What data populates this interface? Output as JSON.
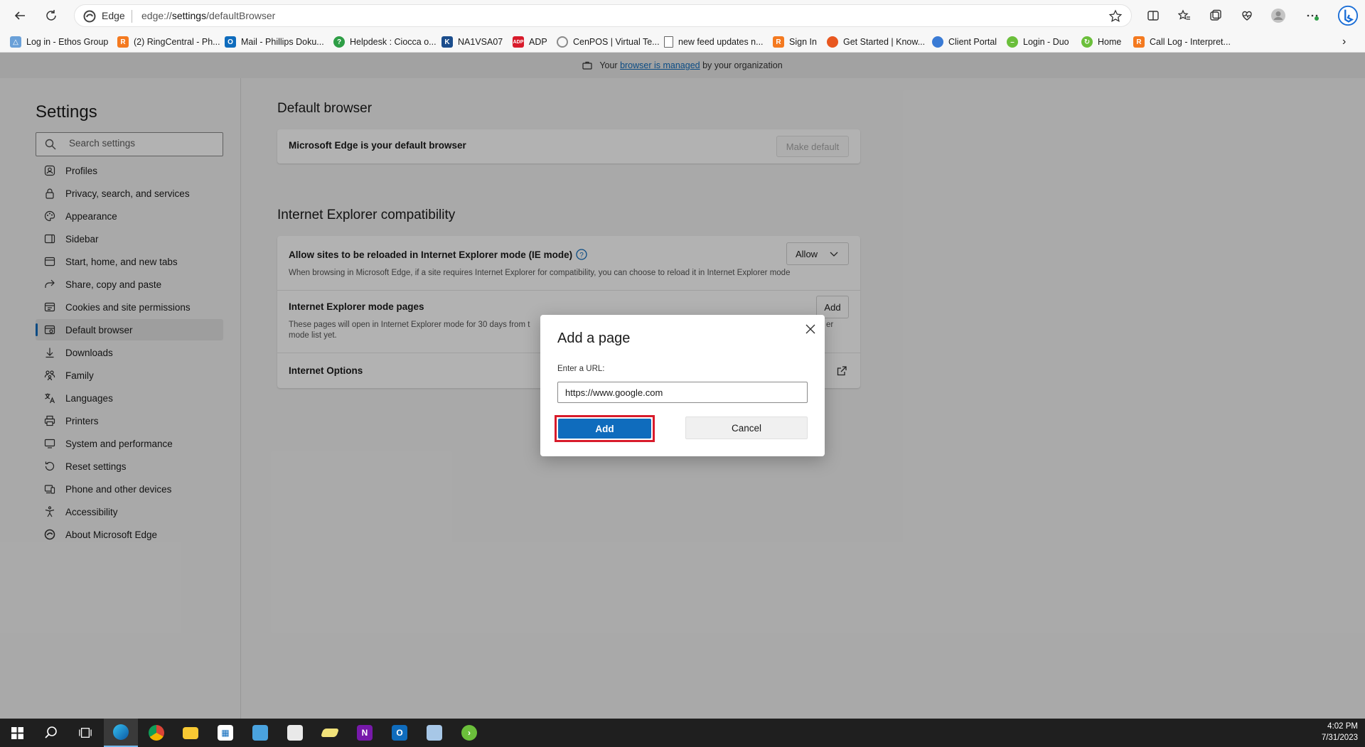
{
  "browser": {
    "site_name": "Edge",
    "url_prefix": "edge://",
    "url_path": "settings",
    "url_rest": "/defaultBrowser"
  },
  "bookmarks": [
    {
      "label": "Log in - Ethos Group",
      "icon": "ethos-icon",
      "color": "#6aa0d8"
    },
    {
      "label": "(2) RingCentral - Ph...",
      "icon": "ringcentral-icon",
      "color": "#f47a20"
    },
    {
      "label": "Mail - Phillips Doku...",
      "icon": "outlook-icon",
      "color": "#0f6cbd"
    },
    {
      "label": "Helpdesk : Ciocca o...",
      "icon": "helpdesk-icon",
      "color": "#2e9e46"
    },
    {
      "label": "NA1VSA07",
      "icon": "kaseya-icon",
      "color": "#1b4d8c"
    },
    {
      "label": "ADP",
      "icon": "adp-icon",
      "color": "#d81b2b"
    },
    {
      "label": "CenPOS | Virtual Te...",
      "icon": "cenpos-icon",
      "color": "#8a8a8a"
    },
    {
      "label": "new feed updates n...",
      "icon": "page-icon",
      "color": "#666666"
    },
    {
      "label": "Sign In",
      "icon": "signin-icon",
      "color": "#f47a20"
    },
    {
      "label": "Get Started | Know...",
      "icon": "knowbe4-icon",
      "color": "#e8571f"
    },
    {
      "label": "Client Portal",
      "icon": "portal-icon",
      "color": "#3a7bd5"
    },
    {
      "label": "Login - Duo",
      "icon": "duo-icon",
      "color": "#6bbf3b"
    },
    {
      "label": "Home",
      "icon": "home-icon",
      "color": "#6bbf3b"
    },
    {
      "label": "Call Log - Interpret...",
      "icon": "calllog-icon",
      "color": "#f47a20"
    }
  ],
  "managed": {
    "prefix": "Your ",
    "link": "browser is managed",
    "suffix": " by your organization"
  },
  "sidebar": {
    "title": "Settings",
    "search_placeholder": "Search settings",
    "items": [
      {
        "label": "Profiles",
        "icon": "profile-icon"
      },
      {
        "label": "Privacy, search, and services",
        "icon": "lock-icon"
      },
      {
        "label": "Appearance",
        "icon": "palette-icon"
      },
      {
        "label": "Sidebar",
        "icon": "sidebar-icon"
      },
      {
        "label": "Start, home, and new tabs",
        "icon": "home-tab-icon"
      },
      {
        "label": "Share, copy and paste",
        "icon": "share-icon"
      },
      {
        "label": "Cookies and site permissions",
        "icon": "cookie-icon"
      },
      {
        "label": "Default browser",
        "icon": "browser-icon",
        "active": true
      },
      {
        "label": "Downloads",
        "icon": "download-icon"
      },
      {
        "label": "Family",
        "icon": "family-icon"
      },
      {
        "label": "Languages",
        "icon": "language-icon"
      },
      {
        "label": "Printers",
        "icon": "printer-icon"
      },
      {
        "label": "System and performance",
        "icon": "system-icon"
      },
      {
        "label": "Reset settings",
        "icon": "reset-icon"
      },
      {
        "label": "Phone and other devices",
        "icon": "phone-icon"
      },
      {
        "label": "Accessibility",
        "icon": "accessibility-icon"
      },
      {
        "label": "About Microsoft Edge",
        "icon": "edge-icon"
      }
    ]
  },
  "main": {
    "default_browser_title": "Default browser",
    "default_browser_status": "Microsoft Edge is your default browser",
    "make_default_label": "Make default",
    "ie_title": "Internet Explorer compatibility",
    "ie_allow_label": "Allow sites to be reloaded in Internet Explorer mode (IE mode)",
    "ie_allow_desc": "When browsing in Microsoft Edge, if a site requires Internet Explorer for compatibility, you can choose to reload it in Internet Explorer mode",
    "ie_allow_value": "Allow",
    "ie_pages_label": "Internet Explorer mode pages",
    "ie_pages_desc_a": "These pages will open in Internet Explorer mode for 30 days from t",
    "ie_pages_desc_b": "mode list yet.",
    "ie_pages_desc_tail": "er",
    "ie_pages_add": "Add",
    "internet_options_label": "Internet Options"
  },
  "dialog": {
    "title": "Add a page",
    "url_label": "Enter a URL:",
    "url_value": "https://www.google.com",
    "add_label": "Add",
    "cancel_label": "Cancel"
  },
  "taskbar": {
    "time": "4:02 PM",
    "date": "7/31/2023"
  },
  "colors": {
    "accent": "#0f6cbd",
    "highlight": "#d81b2b"
  }
}
